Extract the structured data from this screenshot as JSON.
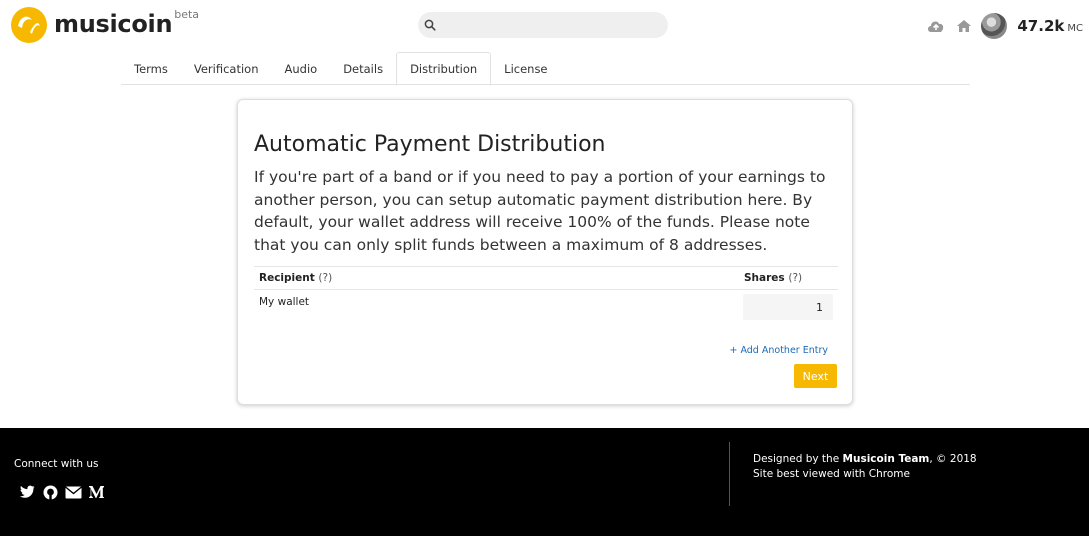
{
  "header": {
    "logo_text": "musicoin",
    "logo_badge": "beta",
    "search_placeholder": "",
    "balance_value": "47.2k",
    "balance_unit": "MC",
    "icons": [
      "upload-cloud-icon",
      "home-icon",
      "avatar"
    ]
  },
  "tabs": [
    {
      "label": "Terms",
      "active": false
    },
    {
      "label": "Verification",
      "active": false
    },
    {
      "label": "Audio",
      "active": false
    },
    {
      "label": "Details",
      "active": false
    },
    {
      "label": "Distribution",
      "active": true
    },
    {
      "label": "License",
      "active": false
    }
  ],
  "card": {
    "title": "Automatic Payment Distribution",
    "description": "If you're part of a band or if you need to pay a portion of your earnings to another person, you can setup automatic payment distribution here. By default, your wallet address will receive 100% of the funds. Please note that you can only split funds between a maximum of 8 addresses.",
    "table": {
      "col_recipient": "Recipient",
      "col_recipient_help": "(?)",
      "col_shares": "Shares",
      "col_shares_help": "(?)",
      "rows": [
        {
          "recipient": "My wallet",
          "shares": "1"
        }
      ]
    },
    "add_entry_label": "+ Add Another Entry",
    "next_label": "Next"
  },
  "footer": {
    "connect_label": "Connect with us",
    "social_icons": [
      "twitter-icon",
      "github-icon",
      "mail-icon",
      "medium-icon"
    ],
    "designed_prefix": "Designed by the ",
    "designed_team": "Musicoin Team",
    "designed_suffix": ", © 2018",
    "best_viewed": "Site best viewed with Chrome"
  },
  "colors": {
    "brand_yellow": "#f6b800",
    "link_blue": "#1a6bb7",
    "footer_bg": "#000000"
  }
}
